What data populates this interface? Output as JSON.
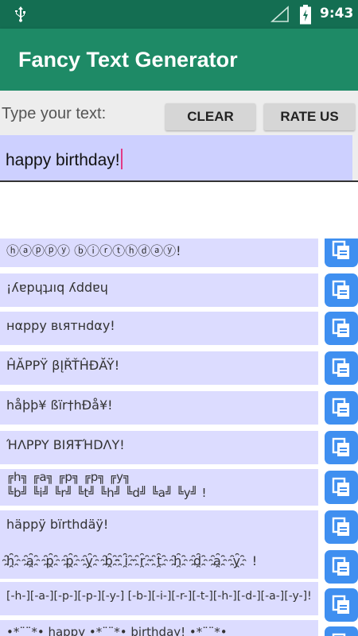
{
  "status_bar": {
    "time": "9:43",
    "icons": [
      "usb-icon",
      "signal-icon",
      "battery-icon"
    ]
  },
  "app_bar": {
    "title": "Fancy Text Generator"
  },
  "controls": {
    "prompt_label": "Type your text:",
    "clear_label": "CLEAR",
    "rate_label": "RATE US",
    "input_value": "happy birthday!"
  },
  "results": [
    {
      "text": "ⓗⓐⓟⓟⓨ ⓑⓘⓡⓣⓗⓓⓐⓨ!"
    },
    {
      "text": "¡ʎɐpɥʇɹıq ʎddɐɥ"
    },
    {
      "text": "нαррy вιятнdαy!"
    },
    {
      "text": "ĤĂРРŸ βĮŘŤĤĐĂŸ!"
    },
    {
      "text": "håþþ¥ ßïr†hÐå¥!"
    },
    {
      "text": "ΉΛPPY BIЯŦΉDΛY!"
    },
    {
      "text": "╔h╗ ╔a╗ ╔p╗ ╔p╗ ╔y╗\n╚b╝ ╚i╝ ╚r╝ ╚t╝ ╚h╝ ╚d╝ ╚a╝ ╚y╝ !"
    },
    {
      "text": "häppÿ bïrthdäÿ!"
    },
    {
      "text": "h҈ a҈ p҈ p҈ y҈ b҈ i҈ r҈ t҈ h҈ d҈ a҈ y҈ !"
    },
    {
      "text": "[-h-][-a-][-p-][-p-][-y-] [-b-][-i-][-r-][-t-][-h-][-d-][-a-][-y-]!"
    },
    {
      "text": "•*¨¨*• happy •*¨¨*• birthday! •*¨¨*•"
    }
  ],
  "colors": {
    "status_bar": "#146e52",
    "app_bar": "#1e8a66",
    "row_background": "#dcdcff",
    "copy_button": "#3f8ff0"
  }
}
